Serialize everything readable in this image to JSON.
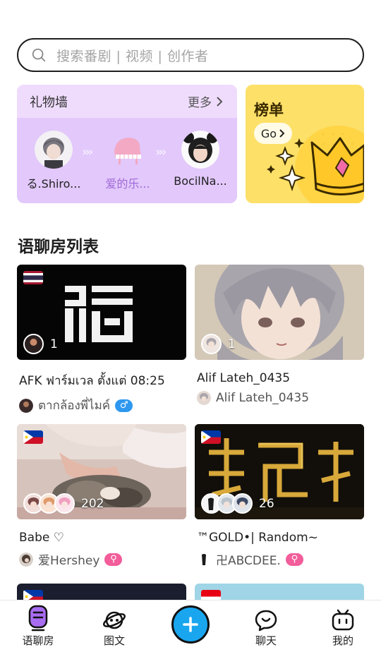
{
  "search": {
    "placeholder": "搜索番剧 | 视频 | 创作者",
    "icon": "search-icon"
  },
  "gift_wall": {
    "title": "礼物墙",
    "more": "更多",
    "items": [
      {
        "label": "る.Shiro...",
        "color": "#222222"
      },
      {
        "label": "爱的乐...",
        "color": "#a06ad8"
      },
      {
        "label": "BocilNa...",
        "color": "#222222"
      }
    ]
  },
  "ranking": {
    "title": "榜单",
    "go": "Go"
  },
  "section_title": "语聊房列表",
  "rooms": [
    {
      "title": "AFK ฟาร์มเวล ตั้งแต่ 08:25",
      "count": "1",
      "host": "ตากล้องพี่ไมค์",
      "badge": "♂",
      "badge_color": "#2e98f0",
      "flag": "thailand"
    },
    {
      "title": "Alif Lateh_0435",
      "count": "1",
      "host": "Alif Lateh_0435",
      "badge": "",
      "flag": ""
    },
    {
      "title": "Babe ♡",
      "count": "202",
      "host": "爱Hershey",
      "badge": "⚲",
      "badge_color": "#f25d9a",
      "flag": "philippines"
    },
    {
      "title": "™GOLD•| Random~",
      "count": "26",
      "host": "卍ABCDEE.",
      "badge": "⚲",
      "badge_color": "#f25d9a",
      "flag": "philippines"
    }
  ],
  "nav": {
    "items": [
      {
        "label": "语聊房",
        "icon": "mic-icon"
      },
      {
        "label": "图文",
        "icon": "planet-icon"
      },
      {
        "label": "",
        "icon": "plus-icon"
      },
      {
        "label": "聊天",
        "icon": "chat-icon"
      },
      {
        "label": "我的",
        "icon": "tv-icon"
      }
    ],
    "accent": "#19a6ef",
    "active_accent": "#a86cf0"
  }
}
